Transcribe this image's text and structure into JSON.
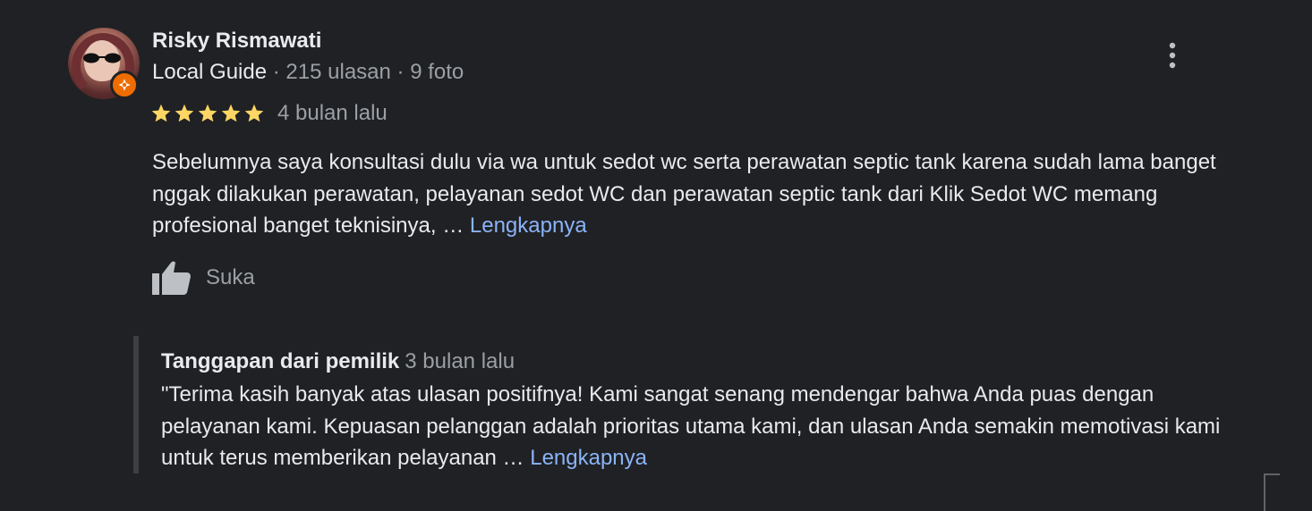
{
  "review": {
    "reviewer_name": "Risky Rismawati",
    "reviewer_badge": "Local Guide",
    "reviewer_sep1": " · ",
    "reviewer_review_count": "215 ulasan",
    "reviewer_sep2": " · ",
    "reviewer_photo_count": "9 foto",
    "rating": 5,
    "rating_max": 5,
    "time": "4 bulan lalu",
    "text": "Sebelumnya saya konsultasi dulu via wa untuk sedot wc serta perawatan septic tank karena sudah lama banget nggak dilakukan perawatan, pelayanan sedot WC dan perawatan septic tank dari Klik Sedot WC memang profesional banget teknisinya, … ",
    "more_link": "Lengkapnya",
    "like_label": "Suka"
  },
  "owner_response": {
    "title": "Tanggapan dari pemilik",
    "time": "3 bulan lalu",
    "text": "\"Terima kasih banyak atas ulasan positifnya! Kami sangat senang mendengar bahwa Anda puas dengan pelayanan kami. Kepuasan pelanggan adalah prioritas utama kami, dan ulasan Anda semakin memotivasi kami untuk terus memberikan pelayanan … ",
    "more_link": "Lengkapnya"
  },
  "colors": {
    "background": "#202124",
    "primary_text": "#e8eaed",
    "secondary_text": "#9aa0a6",
    "link": "#8ab4f8",
    "star": "#fdd663",
    "badge": "#ef6c00"
  },
  "icons": {
    "more": "more-vert-icon",
    "like": "thumb-up-icon",
    "star": "star-icon",
    "badge": "local-guide-badge-icon"
  }
}
